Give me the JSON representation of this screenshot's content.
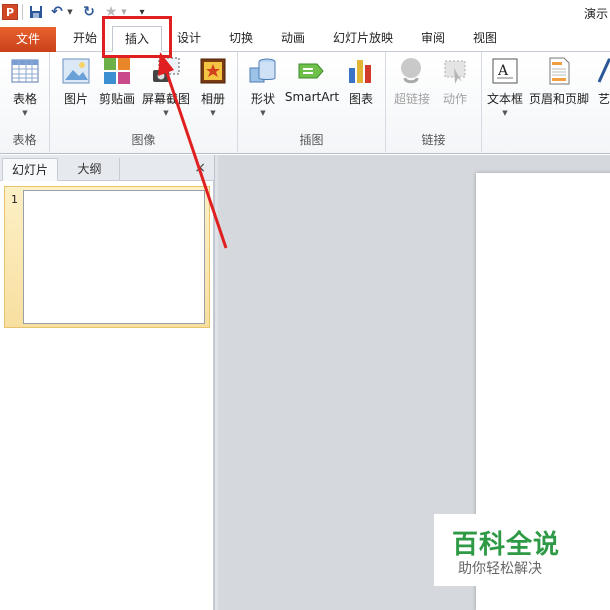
{
  "window": {
    "title_partial": "演示",
    "app_icon_letter": "P"
  },
  "qat": {
    "save": "save-icon",
    "undo": "undo-icon",
    "redo": "redo-icon",
    "favorite": "star-icon"
  },
  "tabs": [
    {
      "label": "文件"
    },
    {
      "label": "开始"
    },
    {
      "label": "插入"
    },
    {
      "label": "设计"
    },
    {
      "label": "切换"
    },
    {
      "label": "动画"
    },
    {
      "label": "幻灯片放映"
    },
    {
      "label": "审阅"
    },
    {
      "label": "视图"
    }
  ],
  "ribbon": {
    "groups": [
      {
        "label": "表格",
        "buttons": [
          {
            "label": "表格"
          }
        ]
      },
      {
        "label": "图像",
        "buttons": [
          {
            "label": "图片"
          },
          {
            "label": "剪贴画"
          },
          {
            "label": "屏幕截图"
          },
          {
            "label": "相册"
          }
        ]
      },
      {
        "label": "插图",
        "buttons": [
          {
            "label": "形状"
          },
          {
            "label": "SmartArt"
          },
          {
            "label": "图表"
          }
        ]
      },
      {
        "label": "链接",
        "buttons": [
          {
            "label": "超链接"
          },
          {
            "label": "动作"
          }
        ]
      },
      {
        "label": "",
        "buttons": [
          {
            "label": "文本框"
          },
          {
            "label": "页眉和页脚"
          },
          {
            "label": "艺术"
          }
        ]
      }
    ]
  },
  "panel": {
    "tab_slides": "幻灯片",
    "tab_outline": "大纲",
    "close": "×",
    "slide_number": "1"
  },
  "watermark": {
    "main": "百科全说",
    "sub": "助你轻松解决"
  },
  "colors": {
    "file_tab": "#d24726",
    "annotation": "#e02020",
    "watermark_green": "#2e9a46",
    "canvas_bg": "#d5d8dc"
  }
}
